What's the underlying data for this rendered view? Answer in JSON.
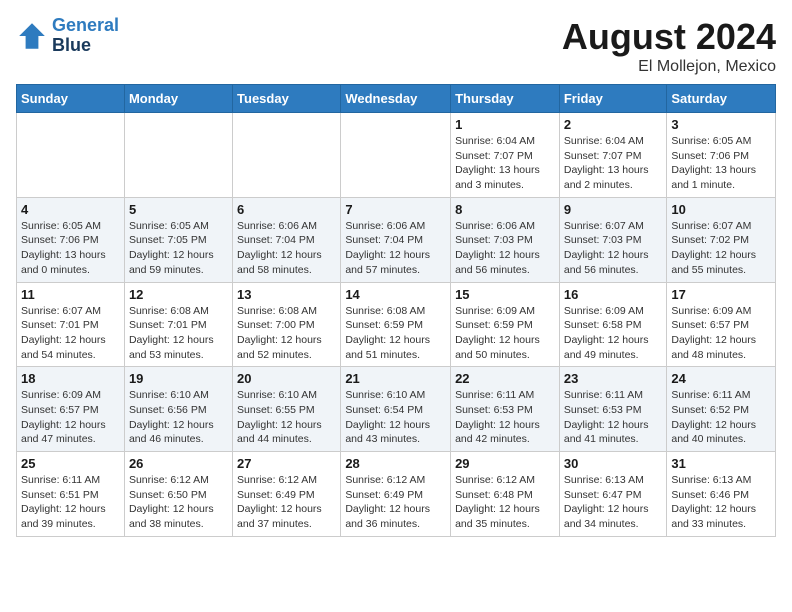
{
  "header": {
    "logo_line1": "General",
    "logo_line2": "Blue",
    "month_year": "August 2024",
    "location": "El Mollejon, Mexico"
  },
  "days_of_week": [
    "Sunday",
    "Monday",
    "Tuesday",
    "Wednesday",
    "Thursday",
    "Friday",
    "Saturday"
  ],
  "weeks": [
    [
      {
        "day": "",
        "info": ""
      },
      {
        "day": "",
        "info": ""
      },
      {
        "day": "",
        "info": ""
      },
      {
        "day": "",
        "info": ""
      },
      {
        "day": "1",
        "info": "Sunrise: 6:04 AM\nSunset: 7:07 PM\nDaylight: 13 hours\nand 3 minutes."
      },
      {
        "day": "2",
        "info": "Sunrise: 6:04 AM\nSunset: 7:07 PM\nDaylight: 13 hours\nand 2 minutes."
      },
      {
        "day": "3",
        "info": "Sunrise: 6:05 AM\nSunset: 7:06 PM\nDaylight: 13 hours\nand 1 minute."
      }
    ],
    [
      {
        "day": "4",
        "info": "Sunrise: 6:05 AM\nSunset: 7:06 PM\nDaylight: 13 hours\nand 0 minutes."
      },
      {
        "day": "5",
        "info": "Sunrise: 6:05 AM\nSunset: 7:05 PM\nDaylight: 12 hours\nand 59 minutes."
      },
      {
        "day": "6",
        "info": "Sunrise: 6:06 AM\nSunset: 7:04 PM\nDaylight: 12 hours\nand 58 minutes."
      },
      {
        "day": "7",
        "info": "Sunrise: 6:06 AM\nSunset: 7:04 PM\nDaylight: 12 hours\nand 57 minutes."
      },
      {
        "day": "8",
        "info": "Sunrise: 6:06 AM\nSunset: 7:03 PM\nDaylight: 12 hours\nand 56 minutes."
      },
      {
        "day": "9",
        "info": "Sunrise: 6:07 AM\nSunset: 7:03 PM\nDaylight: 12 hours\nand 56 minutes."
      },
      {
        "day": "10",
        "info": "Sunrise: 6:07 AM\nSunset: 7:02 PM\nDaylight: 12 hours\nand 55 minutes."
      }
    ],
    [
      {
        "day": "11",
        "info": "Sunrise: 6:07 AM\nSunset: 7:01 PM\nDaylight: 12 hours\nand 54 minutes."
      },
      {
        "day": "12",
        "info": "Sunrise: 6:08 AM\nSunset: 7:01 PM\nDaylight: 12 hours\nand 53 minutes."
      },
      {
        "day": "13",
        "info": "Sunrise: 6:08 AM\nSunset: 7:00 PM\nDaylight: 12 hours\nand 52 minutes."
      },
      {
        "day": "14",
        "info": "Sunrise: 6:08 AM\nSunset: 6:59 PM\nDaylight: 12 hours\nand 51 minutes."
      },
      {
        "day": "15",
        "info": "Sunrise: 6:09 AM\nSunset: 6:59 PM\nDaylight: 12 hours\nand 50 minutes."
      },
      {
        "day": "16",
        "info": "Sunrise: 6:09 AM\nSunset: 6:58 PM\nDaylight: 12 hours\nand 49 minutes."
      },
      {
        "day": "17",
        "info": "Sunrise: 6:09 AM\nSunset: 6:57 PM\nDaylight: 12 hours\nand 48 minutes."
      }
    ],
    [
      {
        "day": "18",
        "info": "Sunrise: 6:09 AM\nSunset: 6:57 PM\nDaylight: 12 hours\nand 47 minutes."
      },
      {
        "day": "19",
        "info": "Sunrise: 6:10 AM\nSunset: 6:56 PM\nDaylight: 12 hours\nand 46 minutes."
      },
      {
        "day": "20",
        "info": "Sunrise: 6:10 AM\nSunset: 6:55 PM\nDaylight: 12 hours\nand 44 minutes."
      },
      {
        "day": "21",
        "info": "Sunrise: 6:10 AM\nSunset: 6:54 PM\nDaylight: 12 hours\nand 43 minutes."
      },
      {
        "day": "22",
        "info": "Sunrise: 6:11 AM\nSunset: 6:53 PM\nDaylight: 12 hours\nand 42 minutes."
      },
      {
        "day": "23",
        "info": "Sunrise: 6:11 AM\nSunset: 6:53 PM\nDaylight: 12 hours\nand 41 minutes."
      },
      {
        "day": "24",
        "info": "Sunrise: 6:11 AM\nSunset: 6:52 PM\nDaylight: 12 hours\nand 40 minutes."
      }
    ],
    [
      {
        "day": "25",
        "info": "Sunrise: 6:11 AM\nSunset: 6:51 PM\nDaylight: 12 hours\nand 39 minutes."
      },
      {
        "day": "26",
        "info": "Sunrise: 6:12 AM\nSunset: 6:50 PM\nDaylight: 12 hours\nand 38 minutes."
      },
      {
        "day": "27",
        "info": "Sunrise: 6:12 AM\nSunset: 6:49 PM\nDaylight: 12 hours\nand 37 minutes."
      },
      {
        "day": "28",
        "info": "Sunrise: 6:12 AM\nSunset: 6:49 PM\nDaylight: 12 hours\nand 36 minutes."
      },
      {
        "day": "29",
        "info": "Sunrise: 6:12 AM\nSunset: 6:48 PM\nDaylight: 12 hours\nand 35 minutes."
      },
      {
        "day": "30",
        "info": "Sunrise: 6:13 AM\nSunset: 6:47 PM\nDaylight: 12 hours\nand 34 minutes."
      },
      {
        "day": "31",
        "info": "Sunrise: 6:13 AM\nSunset: 6:46 PM\nDaylight: 12 hours\nand 33 minutes."
      }
    ]
  ]
}
